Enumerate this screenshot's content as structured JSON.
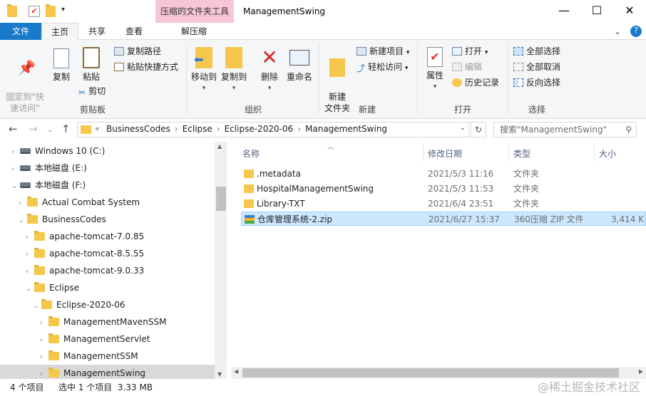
{
  "window": {
    "context_tab": "压缩的文件夹工具",
    "title": "ManagementSwing",
    "minimize": "—",
    "maximize": "☐",
    "close": "✕"
  },
  "tabs": [
    {
      "label": "文件"
    },
    {
      "label": "主页"
    },
    {
      "label": "共享"
    },
    {
      "label": "查看"
    },
    {
      "label": "解压缩"
    }
  ],
  "ribbon": {
    "clipboard": {
      "pin": "固定到\"快\n速访问\"",
      "copy": "复制",
      "paste": "粘贴",
      "copy_path": "复制路径",
      "paste_shortcut": "粘贴快捷方式",
      "cut": "剪切",
      "group": "剪贴板"
    },
    "organize": {
      "move_to": "移动到",
      "copy_to": "复制到",
      "delete": "删除",
      "rename": "重命名",
      "group": "组织"
    },
    "new": {
      "new_folder": "新建\n文件夹",
      "new_item": "新建项目",
      "easy_access": "轻松访问",
      "group": "新建"
    },
    "open": {
      "properties": "属性",
      "open": "打开",
      "edit": "编辑",
      "history": "历史记录",
      "group": "打开"
    },
    "select": {
      "select_all": "全部选择",
      "select_none": "全部取消",
      "invert": "反向选择",
      "group": "选择"
    }
  },
  "address": {
    "crumbs": [
      "BusinessCodes",
      "Eclipse",
      "Eclipse-2020-06",
      "ManagementSwing"
    ],
    "search_placeholder": "搜索\"ManagementSwing\""
  },
  "tree": [
    {
      "label": "Windows 10 (C:)",
      "type": "drive-c",
      "indent": 0,
      "sel": false
    },
    {
      "label": "本地磁盘 (E:)",
      "type": "drive",
      "indent": 0,
      "sel": false
    },
    {
      "label": "本地磁盘 (F:)",
      "type": "drive",
      "indent": 0,
      "sel": false,
      "open": true
    },
    {
      "label": "Actual Combat System",
      "type": "folder",
      "indent": 1,
      "sel": false
    },
    {
      "label": "BusinessCodes",
      "type": "folder",
      "indent": 1,
      "sel": false,
      "open": true
    },
    {
      "label": "apache-tomcat-7.0.85",
      "type": "folder",
      "indent": 2,
      "sel": false
    },
    {
      "label": "apache-tomcat-8.5.55",
      "type": "folder",
      "indent": 2,
      "sel": false
    },
    {
      "label": "apache-tomcat-9.0.33",
      "type": "folder",
      "indent": 2,
      "sel": false
    },
    {
      "label": "Eclipse",
      "type": "folder",
      "indent": 2,
      "sel": false,
      "open": true
    },
    {
      "label": "Eclipse-2020-06",
      "type": "folder",
      "indent": 3,
      "sel": false,
      "open": true
    },
    {
      "label": "ManagementMavenSSM",
      "type": "folder",
      "indent": 4,
      "sel": false
    },
    {
      "label": "ManagementServlet",
      "type": "folder",
      "indent": 4,
      "sel": false
    },
    {
      "label": "ManagementSSM",
      "type": "folder",
      "indent": 4,
      "sel": false
    },
    {
      "label": "ManagementSwing",
      "type": "folder",
      "indent": 4,
      "sel": true
    }
  ],
  "columns": {
    "name": "名称",
    "modified": "修改日期",
    "type": "类型",
    "size": "大小"
  },
  "files": [
    {
      "name": ".metadata",
      "modified": "2021/5/3 11:16",
      "type": "文件夹",
      "size": "",
      "kind": "folder",
      "sel": false
    },
    {
      "name": "HospitalManagementSwing",
      "modified": "2021/5/3 11:53",
      "type": "文件夹",
      "size": "",
      "kind": "folder",
      "sel": false
    },
    {
      "name": "Library-TXT",
      "modified": "2021/6/4 23:51",
      "type": "文件夹",
      "size": "",
      "kind": "folder",
      "sel": false
    },
    {
      "name": "仓库管理系统-2.zip",
      "modified": "2021/6/27 15:37",
      "type": "360压缩 ZIP 文件",
      "size": "3,414 K",
      "kind": "zip",
      "sel": true
    }
  ],
  "status": {
    "count": "4 个项目",
    "selection": "选中 1 个项目  3.33 MB"
  },
  "watermark": "@稀土掘金技术社区"
}
